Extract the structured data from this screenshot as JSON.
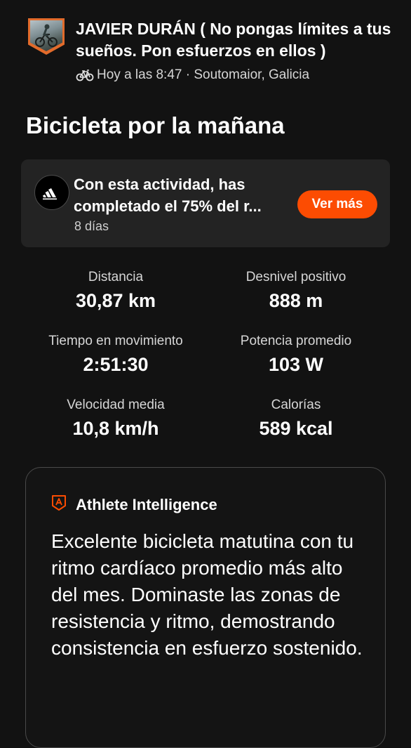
{
  "athlete": {
    "name": "JAVIER DURÁN ( No pongas límites a tus sueños. Pon esfuerzos en ellos )",
    "meta": "Hoy a las 8:47 · Soutomaior, Galicia",
    "activity_icon": "bike-icon"
  },
  "activity": {
    "title": "Bicicleta por la mañana"
  },
  "challenge": {
    "logo": "adidas-logo-icon",
    "text_line1": "Con esta actividad, has",
    "text_line2": "completado el 75% del r...",
    "days": "8 días",
    "button_label": "Ver más",
    "button_color": "#fc4c02"
  },
  "stats": [
    {
      "label": "Distancia",
      "value": "30,87 km"
    },
    {
      "label": "Desnivel positivo",
      "value": "888 m"
    },
    {
      "label": "Tiempo en movimiento",
      "value": "2:51:30"
    },
    {
      "label": "Potencia promedio",
      "value": "103 W"
    },
    {
      "label": "Velocidad media",
      "value": "10,8 km/h"
    },
    {
      "label": "Calorías",
      "value": "589 kcal"
    }
  ],
  "athlete_intelligence": {
    "icon": "athlete-intelligence-icon",
    "title": "Athlete Intelligence",
    "body": "Excelente bicicleta matutina con tu ritmo cardíaco promedio más alto del mes. Dominaste las zonas de resistencia y ritmo, demostrando consistencia en esfuerzo sostenido.",
    "accent_color": "#fc4c02"
  }
}
